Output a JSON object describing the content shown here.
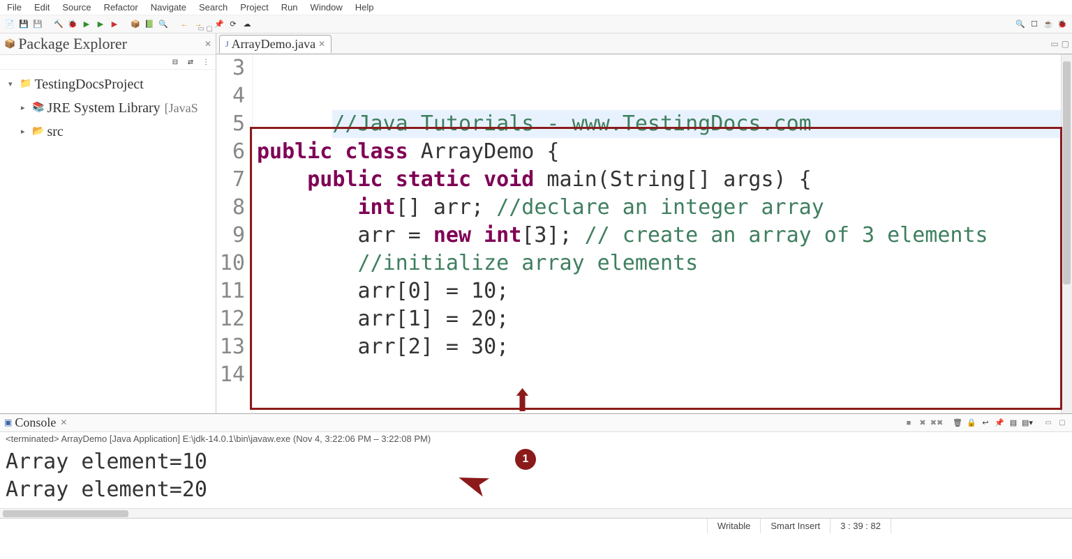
{
  "menubar": [
    "File",
    "Edit",
    "Source",
    "Refactor",
    "Navigate",
    "Search",
    "Project",
    "Run",
    "Window",
    "Help"
  ],
  "sidebar": {
    "view_title": "Package Explorer",
    "project": "TestingDocsProject",
    "library": "JRE System Library",
    "library_suffix": "[JavaS",
    "src": "src"
  },
  "editor": {
    "tab_name": "ArrayDemo.java",
    "lines": [
      {
        "n": 3,
        "tokens": [
          {
            "t": "//Java Tutorials - www.TestingDocs.com",
            "c": "comment"
          }
        ],
        "hl": true
      },
      {
        "n": 4,
        "tokens": [
          {
            "t": "public",
            "c": "kw"
          },
          {
            "t": " "
          },
          {
            "t": "class",
            "c": "kw"
          },
          {
            "t": " ArrayDemo {"
          }
        ]
      },
      {
        "n": 5,
        "tokens": [
          {
            "t": ""
          }
        ]
      },
      {
        "n": 6,
        "tokens": [
          {
            "t": "    "
          },
          {
            "t": "public",
            "c": "kw"
          },
          {
            "t": " "
          },
          {
            "t": "static",
            "c": "kw"
          },
          {
            "t": " "
          },
          {
            "t": "void",
            "c": "kw"
          },
          {
            "t": " main(String[] args) {"
          }
        ]
      },
      {
        "n": 7,
        "tokens": [
          {
            "t": "        "
          },
          {
            "t": "int",
            "c": "kw"
          },
          {
            "t": "[] arr; "
          },
          {
            "t": "//declare an integer array",
            "c": "comment"
          }
        ]
      },
      {
        "n": 8,
        "tokens": [
          {
            "t": "        arr = "
          },
          {
            "t": "new",
            "c": "kw"
          },
          {
            "t": " "
          },
          {
            "t": "int",
            "c": "kw"
          },
          {
            "t": "[3]; "
          },
          {
            "t": "// create an array of 3 elements",
            "c": "comment"
          }
        ]
      },
      {
        "n": 9,
        "tokens": [
          {
            "t": ""
          }
        ]
      },
      {
        "n": 10,
        "tokens": [
          {
            "t": "        "
          },
          {
            "t": "//initialize array elements",
            "c": "comment"
          }
        ]
      },
      {
        "n": 11,
        "tokens": [
          {
            "t": "        arr[0] = 10;"
          }
        ]
      },
      {
        "n": 12,
        "tokens": [
          {
            "t": "        arr[1] = 20;"
          }
        ]
      },
      {
        "n": 13,
        "tokens": [
          {
            "t": "        arr[2] = 30;"
          }
        ]
      },
      {
        "n": 14,
        "tokens": [
          {
            "t": ""
          }
        ]
      }
    ]
  },
  "console": {
    "title": "Console",
    "status": "<terminated> ArrayDemo [Java Application] E:\\jdk-14.0.1\\bin\\javaw.exe  (Nov 4,      3:22:06 PM – 3:22:08 PM)",
    "output": [
      "Array element=10",
      "Array element=20"
    ]
  },
  "statusbar": {
    "mode": "Writable",
    "insert": "Smart Insert",
    "pos": "3 : 39 : 82"
  },
  "annotation": {
    "badge": "1"
  }
}
